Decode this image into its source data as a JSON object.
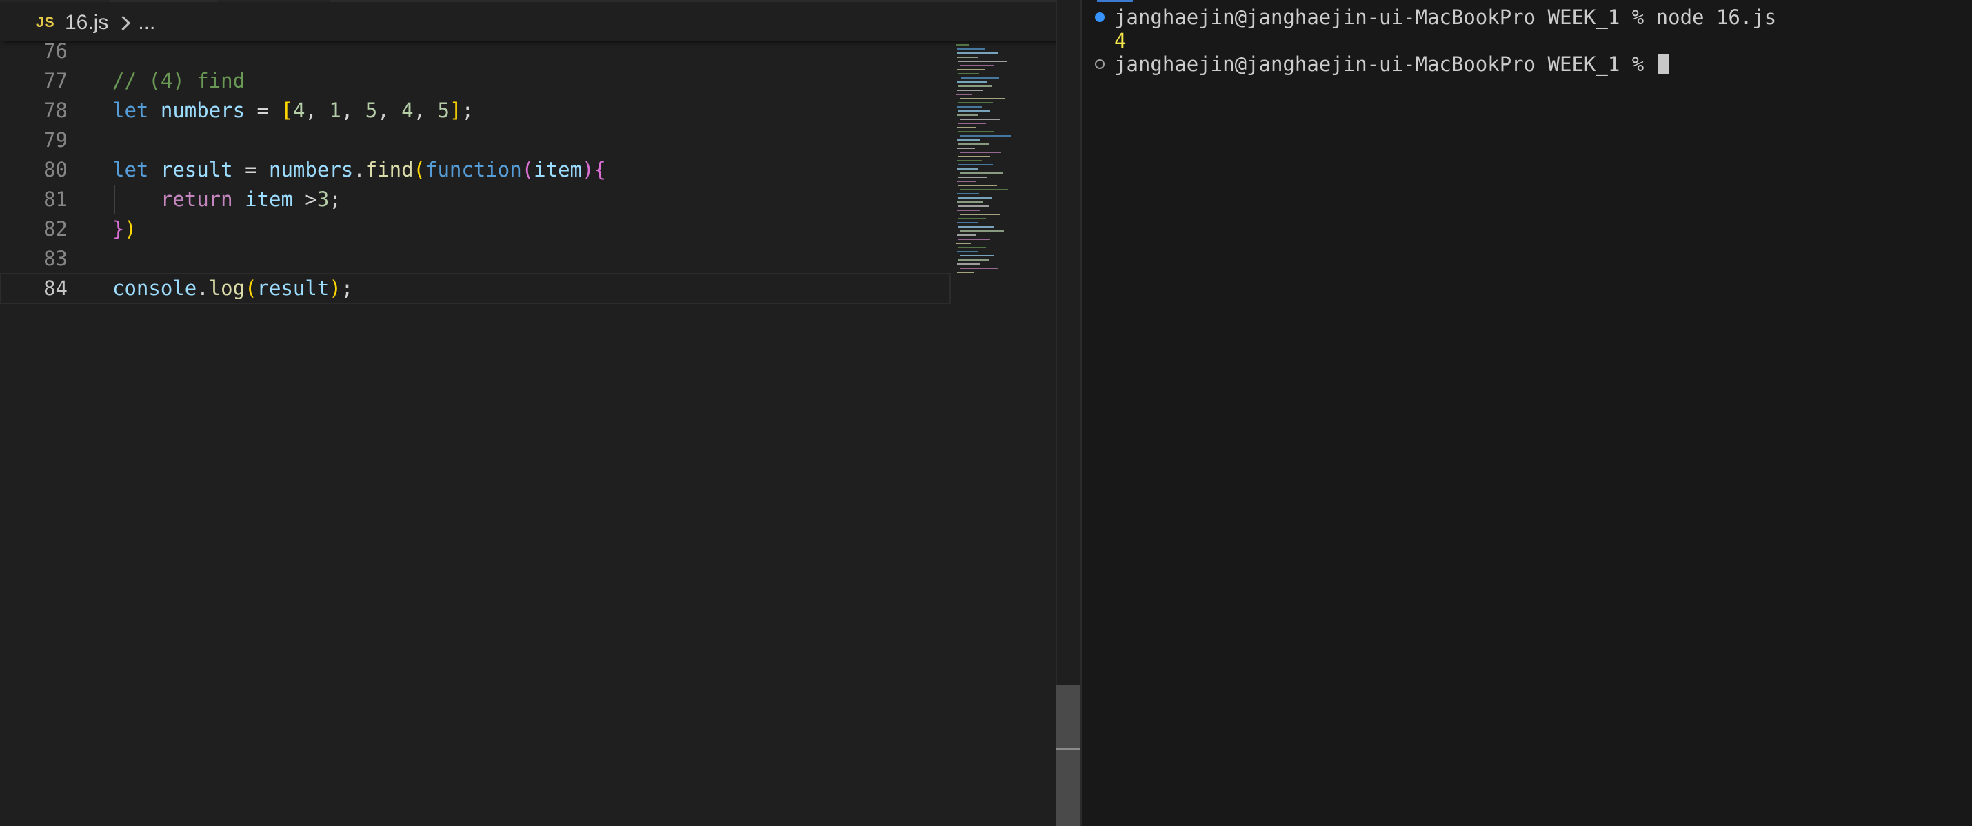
{
  "editor": {
    "breadcrumb": {
      "icon_label": "JS",
      "file": "16.js",
      "more": "..."
    },
    "lines": [
      {
        "number": "76",
        "tokens": []
      },
      {
        "number": "77",
        "tokens": [
          {
            "t": "// (4) find",
            "c": "comment"
          }
        ]
      },
      {
        "number": "78",
        "tokens": [
          {
            "t": "let",
            "c": "kw"
          },
          {
            "t": " ",
            "c": "op"
          },
          {
            "t": "numbers",
            "c": "var"
          },
          {
            "t": " = ",
            "c": "op"
          },
          {
            "t": "[",
            "c": "b1"
          },
          {
            "t": "4",
            "c": "num"
          },
          {
            "t": ", ",
            "c": "op"
          },
          {
            "t": "1",
            "c": "num"
          },
          {
            "t": ", ",
            "c": "op"
          },
          {
            "t": "5",
            "c": "num"
          },
          {
            "t": ", ",
            "c": "op"
          },
          {
            "t": "4",
            "c": "num"
          },
          {
            "t": ", ",
            "c": "op"
          },
          {
            "t": "5",
            "c": "num"
          },
          {
            "t": "]",
            "c": "b1"
          },
          {
            "t": ";",
            "c": "op"
          }
        ]
      },
      {
        "number": "79",
        "tokens": []
      },
      {
        "number": "80",
        "tokens": [
          {
            "t": "let",
            "c": "kw"
          },
          {
            "t": " ",
            "c": "op"
          },
          {
            "t": "result",
            "c": "var"
          },
          {
            "t": " = ",
            "c": "op"
          },
          {
            "t": "numbers",
            "c": "var"
          },
          {
            "t": ".",
            "c": "op"
          },
          {
            "t": "find",
            "c": "fn"
          },
          {
            "t": "(",
            "c": "b1"
          },
          {
            "t": "function",
            "c": "kw"
          },
          {
            "t": "(",
            "c": "b2"
          },
          {
            "t": "item",
            "c": "var"
          },
          {
            "t": ")",
            "c": "b2"
          },
          {
            "t": "{",
            "c": "b2"
          }
        ]
      },
      {
        "number": "81",
        "guide": true,
        "tokens": [
          {
            "t": "    ",
            "c": "op"
          },
          {
            "t": "return",
            "c": "ctrl"
          },
          {
            "t": " ",
            "c": "op"
          },
          {
            "t": "item",
            "c": "var"
          },
          {
            "t": " >",
            "c": "op"
          },
          {
            "t": "3",
            "c": "num"
          },
          {
            "t": ";",
            "c": "op"
          }
        ]
      },
      {
        "number": "82",
        "tokens": [
          {
            "t": "}",
            "c": "b2"
          },
          {
            "t": ")",
            "c": "b1"
          }
        ]
      },
      {
        "number": "83",
        "tokens": []
      },
      {
        "number": "84",
        "current": true,
        "tokens": [
          {
            "t": "console",
            "c": "var"
          },
          {
            "t": ".",
            "c": "op"
          },
          {
            "t": "log",
            "c": "fn"
          },
          {
            "t": "(",
            "c": "b1"
          },
          {
            "t": "result",
            "c": "var"
          },
          {
            "t": ")",
            "c": "b1"
          },
          {
            "t": ";",
            "c": "op"
          }
        ]
      }
    ]
  },
  "terminal": {
    "lines": [
      {
        "decoration": "success",
        "text": "janghaejin@janghaejin-ui-MacBookPro WEEK_1 % node 16.js"
      },
      {
        "output": "4"
      },
      {
        "decoration": "empty",
        "text": "janghaejin@janghaejin-ui-MacBookPro WEEK_1 % ",
        "cursor": true
      }
    ]
  },
  "colors": {
    "editor_bg": "#1f1f1f",
    "terminal_bg": "#181818",
    "comment": "#6a9955",
    "keyword": "#569cd6",
    "control": "#c586c0",
    "variable": "#9cdcfe",
    "number": "#b5cea8",
    "function": "#dcdcaa",
    "bracket_1": "#ffd700",
    "bracket_2": "#da70d6",
    "output": "#f5e84a",
    "success_dot": "#3794ff"
  }
}
